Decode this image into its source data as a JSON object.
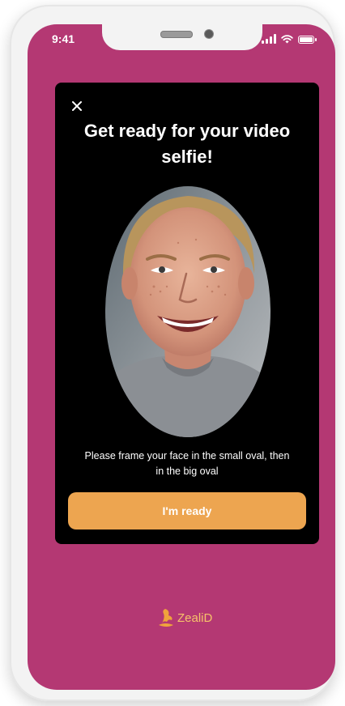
{
  "status_bar": {
    "time": "9:41"
  },
  "modal": {
    "title": "Get ready for your video selfie!",
    "instructions": "Please frame your face in the small oval, then in the big oval",
    "ready_button": "I'm ready",
    "close_icon": "close-icon"
  },
  "brand": {
    "name": "ZealiD",
    "logo_icon": "zealid-logo-icon"
  },
  "colors": {
    "background": "#b43873",
    "card": "#000000",
    "button": "#eda550",
    "brand_text": "#f6c26a"
  }
}
